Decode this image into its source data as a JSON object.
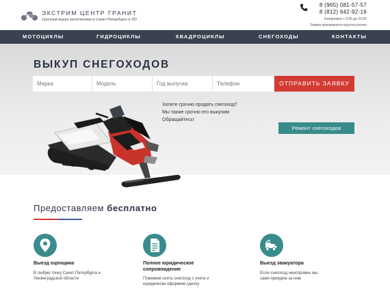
{
  "header": {
    "brand_title": "Экстрим центр Гранит",
    "brand_subtitle": "Срочный выкуп мототехники в Санкт-Петербурге и ЛО",
    "phone1": "8 (965) 081-57-57",
    "phone2": "8 (812) 642-92-16",
    "hours": "Ежедневно с 9:00 до 22:00",
    "hours_note": "Заявки принимаются круглосуточно",
    "logo_icon": "motorcycle-icon",
    "phone_icon": "phone-icon"
  },
  "nav": {
    "items": [
      {
        "label": "Мотоциклы"
      },
      {
        "label": "Гидроциклы"
      },
      {
        "label": "Квадроциклы"
      },
      {
        "label": "Снегоходы"
      },
      {
        "label": "Контакты"
      }
    ]
  },
  "hero": {
    "title": "Выкуп снегоходов",
    "form": {
      "brand_placeholder": "Марка",
      "model_placeholder": "Модель",
      "year_placeholder": "Год выпуска",
      "phone_placeholder": "Телефон",
      "submit_label": "Отправить заявку"
    },
    "text_line1": "Хотите срочно продать снегоход?",
    "text_line2": "Мы также срочно его выкупим",
    "text_line3": "Обращайтесь!",
    "repair_label": "Ремонт снегоходов",
    "accent_color": "#d23c33",
    "teal_color": "#3a8b8c"
  },
  "services": {
    "title_light": "Предоставляем ",
    "title_bold": "бесплатно",
    "items": [
      {
        "icon": "location-pin-icon",
        "title1": "Выезд оценщика",
        "title2": "",
        "desc1": "В любую точку Санкт-Петербурга и",
        "desc2": "Ленинградской области"
      },
      {
        "icon": "document-icon",
        "title1": "Полное юридическое",
        "title2": "сопровождение",
        "desc1": "Поможем снять снегоход с учета и",
        "desc2": "юридически оформим сделку"
      },
      {
        "icon": "tow-truck-icon",
        "title1": "Выезд эвакуатора",
        "title2": "",
        "desc1": "Если снегоход неисправен мы",
        "desc2": "сами приедем за ним"
      }
    ]
  }
}
